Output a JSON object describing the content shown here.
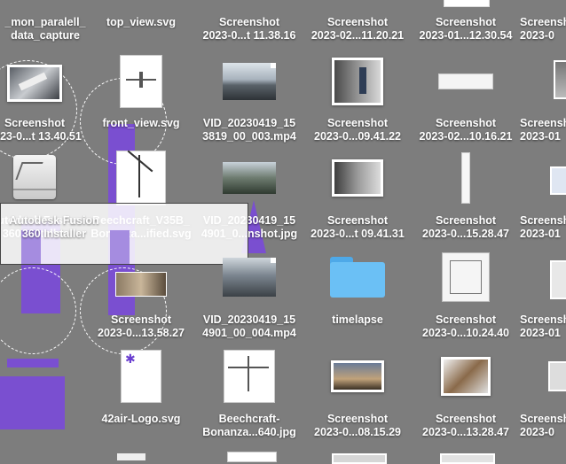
{
  "desktop": {
    "files": [
      {
        "id": "r0c0",
        "line1": "_mon_paralell_",
        "line2": "data_capture"
      },
      {
        "id": "r0c1",
        "line1": "top_view.svg",
        "line2": ""
      },
      {
        "id": "r0c2",
        "line1": "Screenshot",
        "line2": "2023-0...t 11.38.16"
      },
      {
        "id": "r0c3",
        "line1": "Screenshot",
        "line2": "2023-02...11.20.21"
      },
      {
        "id": "r0c4",
        "line1": "Screenshot",
        "line2": "2023-01...12.30.54"
      },
      {
        "id": "r0c5",
        "line1": "Screenshot",
        "line2": "2023-0"
      },
      {
        "id": "r1c0",
        "line1": "Screenshot",
        "line2": "2023-0...t 13.40.51"
      },
      {
        "id": "r1c1",
        "line1": "front_view.svg",
        "line2": ""
      },
      {
        "id": "r1c2",
        "line1": "VID_20230419_15",
        "line2": "3819_00_003.mp4"
      },
      {
        "id": "r1c3",
        "line1": "Screenshot",
        "line2": "2023-0...09.41.22"
      },
      {
        "id": "r1c4",
        "line1": "Screenshot",
        "line2": "2023-02...10.16.21"
      },
      {
        "id": "r1c5",
        "line1": "Screenshot",
        "line2": "2023-01"
      },
      {
        "id": "r2c0",
        "line1": "Autodesk Fusion",
        "line2": "360 Installer"
      },
      {
        "id": "r2c1",
        "line1": "Beechcraft_V35B_",
        "line2": "Bonanza...ified.svg"
      },
      {
        "id": "r2c2",
        "line1": "VID_20230419_15",
        "line2": "4901_0...nshot.jpg"
      },
      {
        "id": "r2c3",
        "line1": "Screenshot",
        "line2": "2023-0...t 09.41.31"
      },
      {
        "id": "r2c4",
        "line1": "Screenshot",
        "line2": "2023-0...15.28.47"
      },
      {
        "id": "r2c5",
        "line1": "Screenshot",
        "line2": "2023-01"
      },
      {
        "id": "r3c1",
        "line1": "Screenshot",
        "line2": "2023-0...13.58.27"
      },
      {
        "id": "r3c2",
        "line1": "VID_20230419_15",
        "line2": "4901_00_004.mp4"
      },
      {
        "id": "r3c3",
        "line1": "timelapse",
        "line2": ""
      },
      {
        "id": "r3c4",
        "line1": "Screenshot",
        "line2": "2023-0...10.24.40"
      },
      {
        "id": "r3c5",
        "line1": "Screenshot",
        "line2": "2023-01"
      },
      {
        "id": "r4c1",
        "line1": "42air-Logo.svg",
        "line2": ""
      },
      {
        "id": "r4c2",
        "line1": "Beechcraft-",
        "line2": "Bonanza...640.jpg"
      },
      {
        "id": "r4c3",
        "line1": "Screenshot",
        "line2": "2023-0...08.15.29"
      },
      {
        "id": "r4c4",
        "line1": "Screenshot",
        "line2": "2023-0...13.28.47"
      },
      {
        "id": "r4c5",
        "line1": "Screenshot",
        "line2": "2023-0"
      }
    ]
  },
  "colors": {
    "desktop_bg": "#7d7d7d",
    "overlay_purple": "#7a4fd0",
    "folder_blue": "#6bc0f5"
  }
}
